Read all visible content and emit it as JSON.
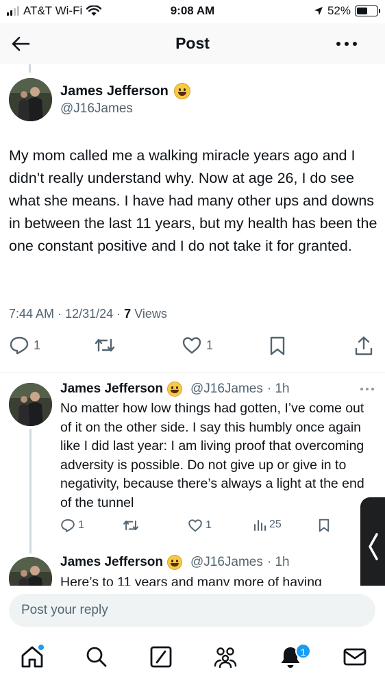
{
  "status_bar": {
    "carrier": "AT&T Wi-Fi",
    "time": "9:08 AM",
    "battery_percent": "52%",
    "battery_level": 0.52
  },
  "header": {
    "title": "Post"
  },
  "main_post": {
    "author_name": "James Jefferson",
    "author_handle": "@J16James",
    "text": "My mom called me a walking miracle years ago and I didn’t really understand why. Now at age 26, I do see what she means. I have had many other ups and downs in between the last 11 years, but my health has been the one constant positive and I do not take it for granted.",
    "time": "7:44 AM",
    "date": "12/31/24",
    "views_count": "7",
    "views_label": "Views",
    "replies": "1",
    "likes": "1",
    "icons": [
      "reply-icon",
      "repost-icon",
      "like-icon",
      "bookmark-icon",
      "share-icon"
    ]
  },
  "replies": [
    {
      "author_name": "James Jefferson",
      "author_handle": "@J16James",
      "time": "· 1h",
      "text": "No matter how low things had gotten, I’ve come out of it on the other side. I say this humbly once again like I did last year: I am living proof that overcoming adversity is possible. Do not give up or give in to negativity, because there’s always a light at the end of the tunnel",
      "replies": "1",
      "likes": "1",
      "views": "25"
    },
    {
      "author_name": "James Jefferson",
      "author_handle": "@J16James",
      "time": "· 1h",
      "text": "Here’s to 11 years and many more of having"
    }
  ],
  "reply_box": {
    "placeholder": "Post your reply"
  },
  "bottom_nav": {
    "items": [
      "home-icon",
      "search-icon",
      "grok-icon",
      "communities-icon",
      "notifications-icon",
      "messages-icon"
    ],
    "notification_badge": "1"
  }
}
